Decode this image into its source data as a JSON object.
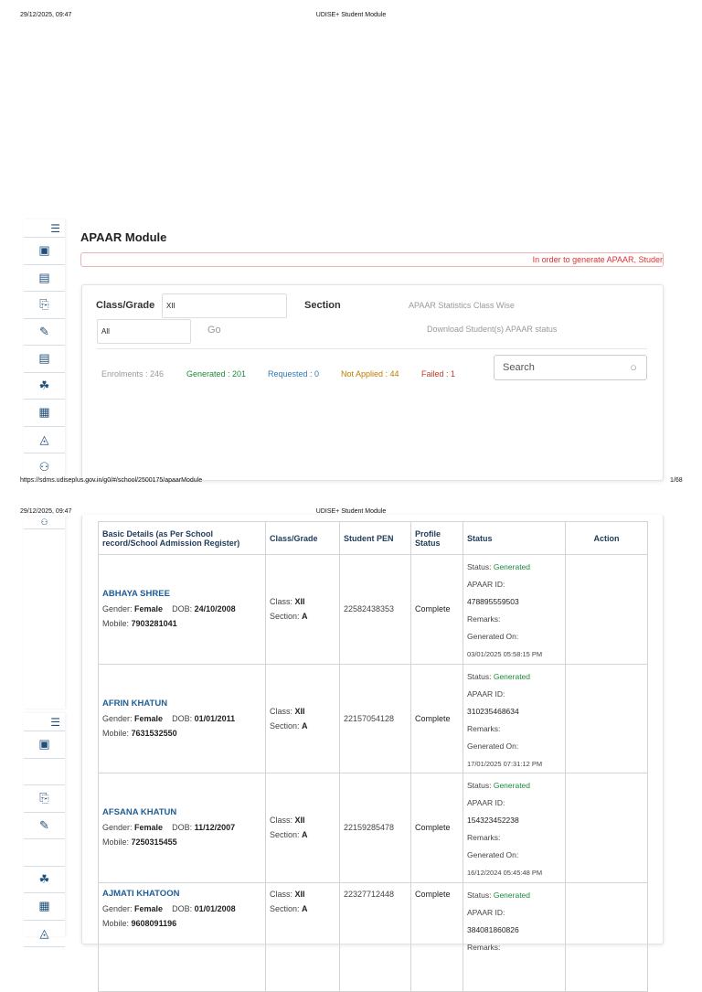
{
  "print_header": {
    "datetime": "29/12/2025, 09:47",
    "title": "UDISE+ Student Module"
  },
  "print_footer": {
    "url": "https://sdms.udiseplus.gov.in/g0/#/school/2500175/apaarModule",
    "page": "1/68"
  },
  "page_title": "APAAR Module",
  "alert": "In order to generate APAAR, Studer",
  "filters": {
    "class_label": "Class/Grade",
    "class_value": "XII",
    "section_label": "Section",
    "section_value": "All",
    "go": "Go",
    "stats_link": "APAAR Statistics Class Wise",
    "download_link": "Download Student(s) APAAR status",
    "search_placeholder": "Search"
  },
  "stats": {
    "enrolments": "Enrolments : 246",
    "generated": "Generated : 201",
    "requested": "Requested : 0",
    "not_applied": "Not Applied : 44",
    "failed": "Failed : 1"
  },
  "colors": {
    "generated": "#1a8a3a",
    "requested": "#2a7ab8",
    "not_applied": "#c07a00",
    "failed": "#c0392b",
    "alert": "#e03030"
  },
  "table": {
    "headers": [
      "Basic Details (as Per School record/School Admission Register)",
      "Class/Grade",
      "Student PEN",
      "Profile Status",
      "Status",
      "Action"
    ],
    "labels": {
      "gender": "Gender:",
      "dob": "DOB:",
      "mobile": "Mobile:",
      "class": "Class:",
      "section": "Section:",
      "status": "Status:",
      "apaar": "APAAR ID:",
      "remarks": "Remarks:",
      "gen_on": "Generated On:"
    },
    "rows": [
      {
        "name": "ABHAYA SHREE",
        "gender": "Female",
        "dob": "24/10/2008",
        "mobile": "7903281041",
        "class": "XII",
        "section": "A",
        "pen": "22582438353",
        "profile": "Complete",
        "status": "Generated",
        "apaar_id": "478895559503",
        "generated_on": "03/01/2025 05:58:15 PM"
      },
      {
        "name": "AFRIN KHATUN",
        "gender": "Female",
        "dob": "01/01/2011",
        "mobile": "7631532550",
        "class": "XII",
        "section": "A",
        "pen": "22157054128",
        "profile": "Complete",
        "status": "Generated",
        "apaar_id": "310235468634",
        "generated_on": "17/01/2025 07:31:12 PM"
      },
      {
        "name": "AFSANA KHATUN",
        "gender": "Female",
        "dob": "11/12/2007",
        "mobile": "7250315455",
        "class": "XII",
        "section": "A",
        "pen": "22159285478",
        "profile": "Complete",
        "status": "Generated",
        "apaar_id": "154323452238",
        "generated_on": "16/12/2024 05:45:48 PM"
      },
      {
        "name": "AJMATI KHATOON",
        "gender": "Female",
        "dob": "01/01/2008",
        "mobile": "9608091196",
        "class": "XII",
        "section": "A",
        "pen": "22327712448",
        "profile": "Complete",
        "status": "Generated",
        "apaar_id": "384081860826"
      }
    ]
  }
}
